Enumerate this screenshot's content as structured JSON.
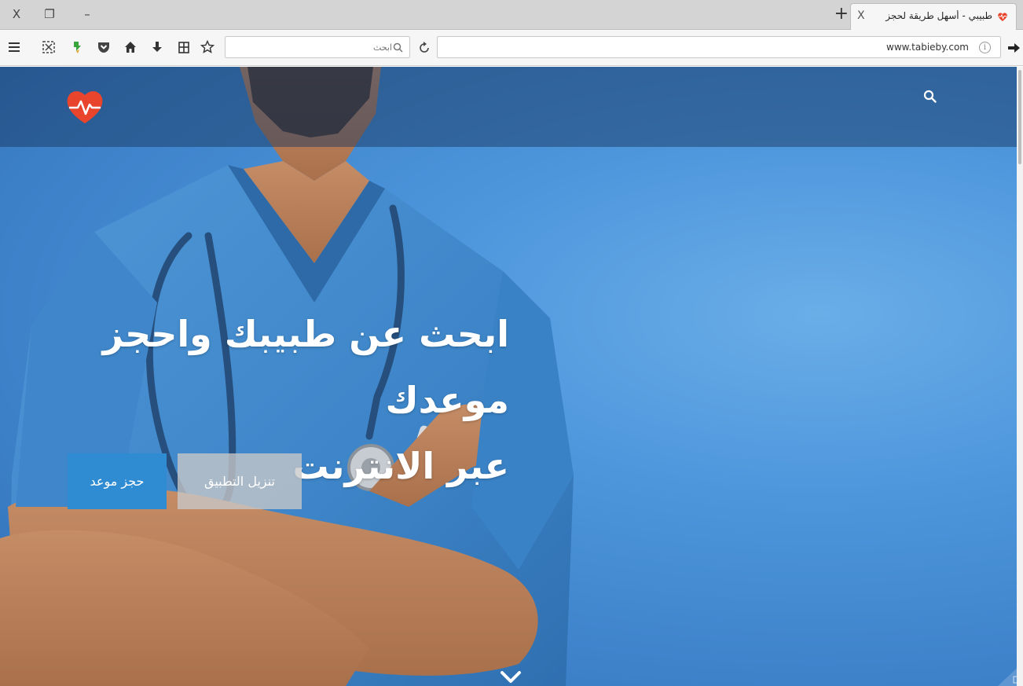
{
  "browser": {
    "window_controls": {
      "close": "X",
      "restore": "❐",
      "minimize": "–"
    },
    "tab": {
      "title": "طبيبي - أسهل طريقة لحجز",
      "close": "X"
    },
    "new_tab": "+",
    "search": {
      "placeholder": "ابحث"
    },
    "url": "www.tabieby.com",
    "info_glyph": "i"
  },
  "toolbar_icons": [
    "menu-icon",
    "screenshot-icon",
    "extension-icon",
    "pocket-icon",
    "home-icon",
    "download-icon",
    "library-icon",
    "bookmark-star-icon"
  ],
  "page": {
    "hero": {
      "title_line1": "ابحث عن طبيبك واحجز موعدك",
      "title_line2": "عبر الانترنت",
      "book_button": "حجز موعد",
      "app_button": "تنزيل التطبيق"
    }
  },
  "colors": {
    "accent": "#2f8bd2",
    "logo": "#e8452c",
    "secondary_button": "#c8c8c8",
    "background": "#4d96dc"
  }
}
